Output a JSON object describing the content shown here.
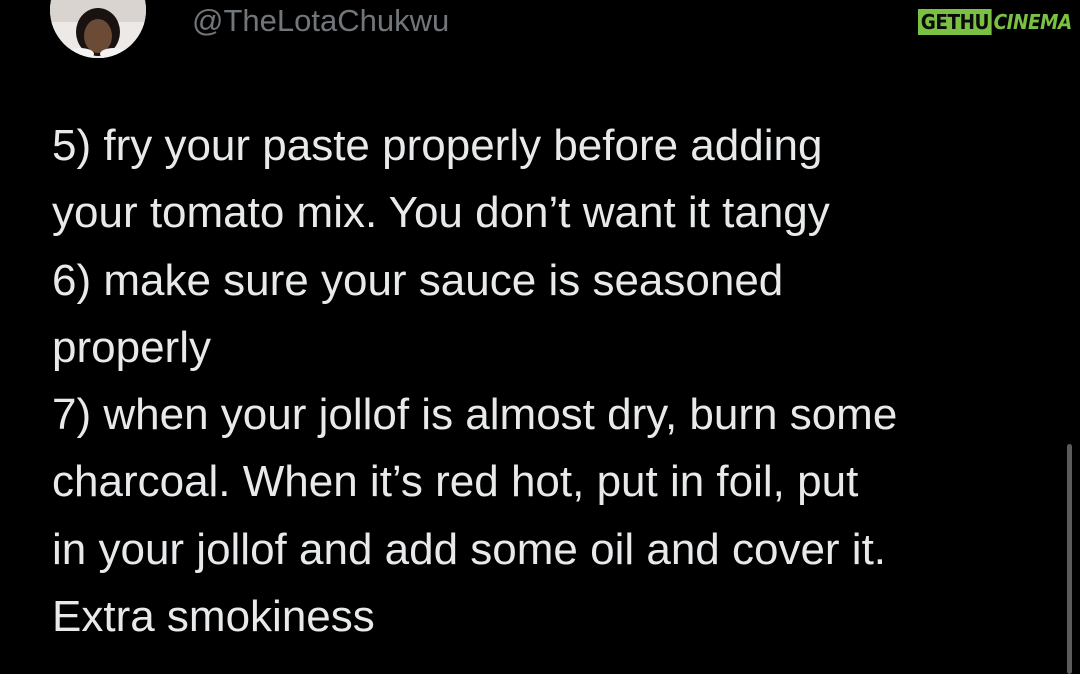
{
  "tweet": {
    "handle": "@TheLotaChukwu",
    "lines": [
      "5) fry your paste properly before adding",
      "your tomato mix. You don’t want it tangy",
      "6) make sure your sauce is seasoned",
      "properly",
      "7) when your jollof is almost dry, burn some",
      "charcoal. When it’s red hot, put in foil, put",
      "in your jollof and add some oil and cover it.",
      "Extra smokiness"
    ]
  },
  "watermark": {
    "part1": "GETHU",
    "part2": "CINEMA"
  },
  "colors": {
    "background": "#000000",
    "text": "#e7e9ea",
    "handle": "#71767b",
    "watermark": "#7ac143"
  }
}
